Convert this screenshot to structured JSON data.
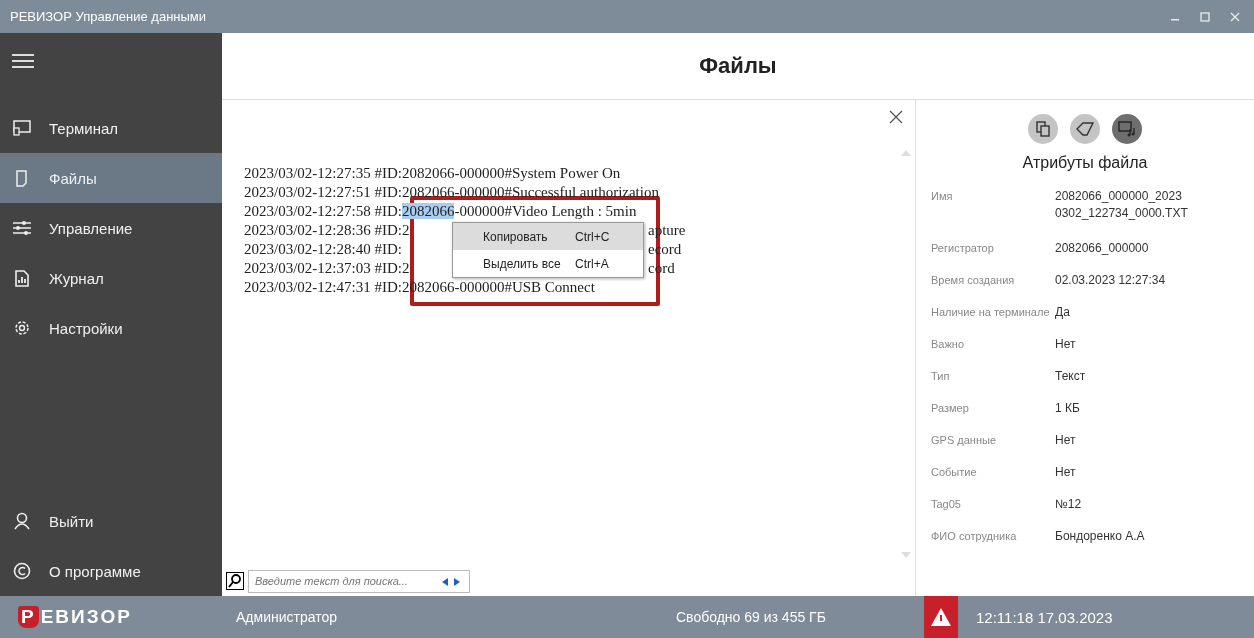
{
  "window": {
    "title": "РЕВИЗОР Управление данными"
  },
  "sidebar": {
    "items": [
      {
        "label": "Терминал",
        "selected": false
      },
      {
        "label": "Файлы",
        "selected": true
      },
      {
        "label": "Управление",
        "selected": false
      },
      {
        "label": "Журнал",
        "selected": false
      },
      {
        "label": "Настройки",
        "selected": false
      }
    ],
    "bottom_items": [
      {
        "label": "Выйти"
      },
      {
        "label": "О программе"
      }
    ]
  },
  "header": {
    "title": "Файлы"
  },
  "log": {
    "lines": [
      {
        "start": "2023/03/02-12:27:35 #ID:2082066-000000#System Power On"
      },
      {
        "start": "2023/03/02-12:27:51 #ID:2082066-000000#Successful authorization"
      },
      {
        "start": "2023/03/02-12:27:58 #ID:",
        "selected": "2082066",
        "end": "-000000#Video Length : 5min"
      },
      {
        "start": "2023/03/02-12:28:36 #ID:2",
        "end": "apture"
      },
      {
        "start": "2023/03/02-12:28:40 #ID:",
        "end": "ecord"
      },
      {
        "start": "2023/03/02-12:37:03 #ID:2",
        "end": "cord"
      },
      {
        "start": "2023/03/02-12:47:31 #ID:2082066-000000#USB Connect"
      }
    ]
  },
  "context_menu": [
    {
      "label": "Копировать",
      "shortcut": "Ctrl+C",
      "highlighted": true
    },
    {
      "label": "Выделить все",
      "shortcut": "Ctrl+A",
      "highlighted": false
    }
  ],
  "search": {
    "placeholder": "Введите текст для поиска..."
  },
  "attributes": {
    "tools": [
      {
        "selected": false
      },
      {
        "selected": false
      },
      {
        "selected": true
      }
    ],
    "title": "Атрибуты файла",
    "rows": [
      {
        "label": "Имя",
        "value": "2082066_000000_2023 0302_122734_0000.TXT"
      },
      {
        "label": "Регистратор",
        "value": "2082066_000000"
      },
      {
        "label": "Время создания",
        "value": "02.03.2023 12:27:34"
      },
      {
        "label": "Наличие на терминале",
        "value": "Да"
      },
      {
        "label": "Важно",
        "value": "Нет"
      },
      {
        "label": "Тип",
        "value": "Текст"
      },
      {
        "label": "Размер",
        "value": "1 КБ"
      },
      {
        "label": "GPS данные",
        "value": "Нет"
      },
      {
        "label": "Событие",
        "value": "Нет"
      },
      {
        "label": "Tag05",
        "value": "№12"
      },
      {
        "label": "ФИО сотрудника",
        "value": "Бондоренко А.А"
      }
    ]
  },
  "status_bar": {
    "logo_first": "Р",
    "logo_rest": "ЕВИЗОР",
    "user": "Администратор",
    "free_space": "Свободно 69 из 455 ГБ",
    "warning": true,
    "datetime": "12:11:18 17.03.2023"
  }
}
